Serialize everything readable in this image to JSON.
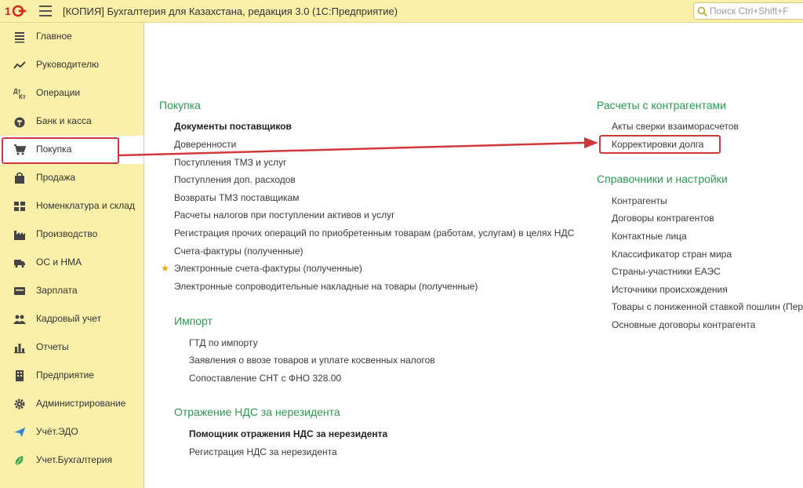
{
  "titlebar": {
    "title": "[КОПИЯ] Бухгалтерия для Казахстана, редакция 3.0  (1С:Предприятие)",
    "search_placeholder": "Поиск Ctrl+Shift+F",
    "logo_icon": "1c-logo-icon",
    "menu_icon": "hamburger-menu-icon"
  },
  "sidebar": {
    "active_index": 4,
    "items": [
      {
        "label": "Главное",
        "icon": "list-icon"
      },
      {
        "label": "Руководителю",
        "icon": "trend-chart-icon"
      },
      {
        "label": "Операции",
        "icon": "dt-kt-icon"
      },
      {
        "label": "Банк и касса",
        "icon": "money-bag-icon"
      },
      {
        "label": "Покупка",
        "icon": "shopping-cart-icon"
      },
      {
        "label": "Продажа",
        "icon": "shopping-bag-icon"
      },
      {
        "label": "Номенклатура и склад",
        "icon": "grid-icon"
      },
      {
        "label": "Производство",
        "icon": "factory-icon"
      },
      {
        "label": "ОС и НМА",
        "icon": "truck-icon"
      },
      {
        "label": "Зарплата",
        "icon": "wallet-icon"
      },
      {
        "label": "Кадровый учет",
        "icon": "people-icon"
      },
      {
        "label": "Отчеты",
        "icon": "bar-chart-icon"
      },
      {
        "label": "Предприятие",
        "icon": "building-icon"
      },
      {
        "label": "Администрирование",
        "icon": "gear-icon"
      },
      {
        "label": "Учёт.ЭДО",
        "icon": "paper-plane-icon"
      },
      {
        "label": "Учет.Бухгалтерия",
        "icon": "leaf-icon"
      }
    ]
  },
  "main": {
    "purchase": {
      "title": "Покупка",
      "links": [
        "Документы поставщиков",
        "Доверенности",
        "Поступления ТМЗ и услуг",
        "Поступления доп. расходов",
        "Возвраты ТМЗ поставщикам",
        "Расчеты налогов при поступлении активов и услуг",
        "Регистрация прочих операций по приобретенным товарам (работам, услугам) в целях НДС",
        "Счета-фактуры (полученные)",
        "Электронные счета-фактуры (полученные)",
        "Электронные сопроводительные накладные на товары (полученные)"
      ]
    },
    "import": {
      "title": "Импорт",
      "links": [
        "ГТД по импорту",
        "Заявления о ввозе товаров и уплате косвенных налогов",
        "Сопоставление СНТ с ФНО 328.00"
      ]
    },
    "vat": {
      "title": "Отражение НДС за нерезидента",
      "links": [
        "Помощник отражения НДС за нерезидента",
        "Регистрация НДС за нерезидента"
      ]
    },
    "settlements": {
      "title": "Расчеты с контрагентами",
      "links": [
        "Акты сверки взаиморасчетов",
        "Корректировки долга"
      ]
    },
    "references": {
      "title": "Справочники и настройки",
      "links": [
        "Контрагенты",
        "Договоры контрагентов",
        "Контактные лица",
        "Классификатор стран мира",
        "Страны-участники ЕАЭС",
        "Источники происхождения",
        "Товары с пониженной ставкой пошлин (Перечень)",
        "Основные договоры контрагента"
      ]
    },
    "favorite_star": "★"
  },
  "colors": {
    "accent_green": "#2a9a50",
    "panel_yellow": "#fbf0a9",
    "highlight_red": "#d0393c",
    "star": "#f2a31a"
  }
}
